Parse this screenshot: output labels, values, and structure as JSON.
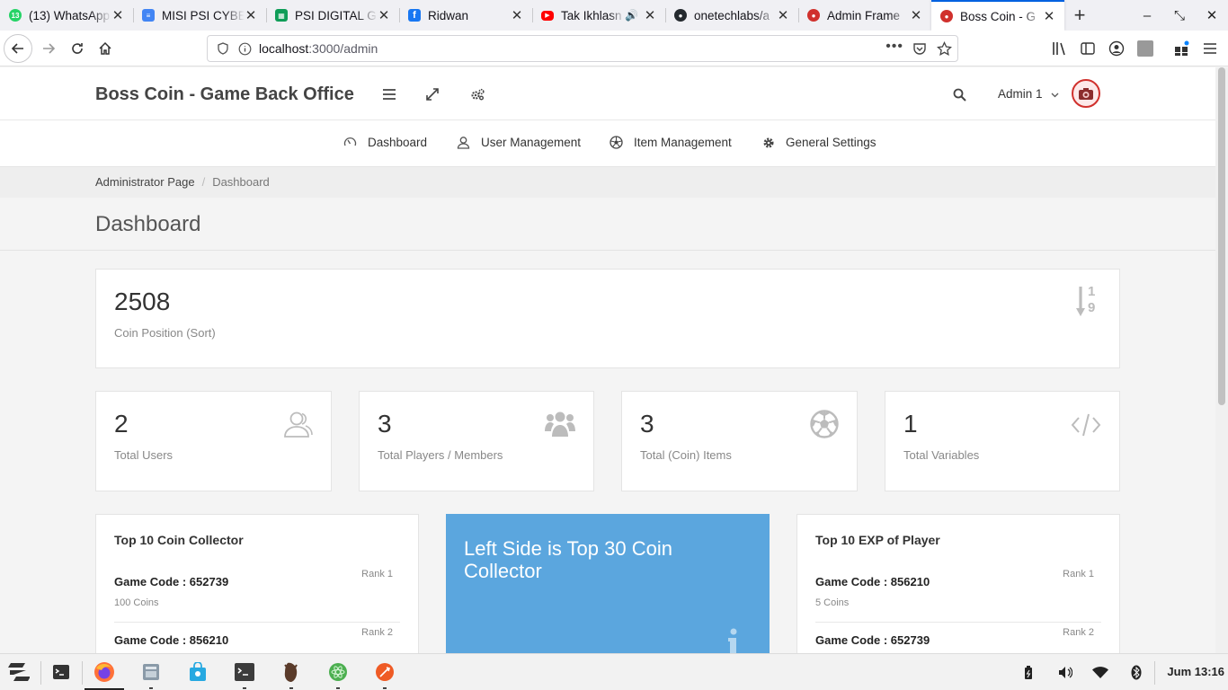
{
  "browser": {
    "tabs": [
      {
        "title": "(13) WhatsApp",
        "icon": "whatsapp-icon",
        "badge": "13",
        "color": "#25d366"
      },
      {
        "title": "MISI PSI CYBER",
        "icon": "google-docs-icon",
        "color": "#4285f4"
      },
      {
        "title": "PSI DIGITAL G",
        "icon": "google-sheets-icon",
        "color": "#0f9d58"
      },
      {
        "title": "Ridwan",
        "icon": "facebook-icon",
        "color": "#1877f2"
      },
      {
        "title": "Tak Ikhlasn",
        "icon": "youtube-icon",
        "color": "#ff0000"
      },
      {
        "title": "onetechlabs/a",
        "icon": "github-icon",
        "color": "#24292e"
      },
      {
        "title": "Admin Frame",
        "icon": "app-icon",
        "color": "#d0312d"
      },
      {
        "title": "Boss Coin - G",
        "icon": "app-icon",
        "color": "#d0312d",
        "active": true
      }
    ],
    "url_host": "localhost",
    "url_path": ":3000/admin"
  },
  "header": {
    "brand": "Boss Coin - Game Back Office",
    "admin_name": "Admin 1"
  },
  "nav": {
    "items": [
      {
        "label": "Dashboard",
        "icon": "dashboard-gauge-icon"
      },
      {
        "label": "User Management",
        "icon": "user-icon"
      },
      {
        "label": "Item Management",
        "icon": "soccer-ball-icon"
      },
      {
        "label": "General Settings",
        "icon": "gear-icon"
      }
    ]
  },
  "breadcrumb": {
    "root": "Administrator Page",
    "separator": "/",
    "current": "Dashboard"
  },
  "page": {
    "title": "Dashboard"
  },
  "stats": {
    "coin_position": {
      "value": "2508",
      "label": "Coin Position (Sort)",
      "icon": "sort-numeric-icon",
      "icon_digits": [
        "1",
        "9"
      ]
    },
    "cards": [
      {
        "value": "2",
        "label": "Total Users",
        "icon": "users-outline-icon"
      },
      {
        "value": "3",
        "label": "Total Players / Members",
        "icon": "group-icon"
      },
      {
        "value": "3",
        "label": "Total (Coin) Items",
        "icon": "soccer-ball-icon"
      },
      {
        "value": "1",
        "label": "Total Variables",
        "icon": "code-icon"
      }
    ]
  },
  "top_coin": {
    "title": "Top 10 Coin Collector",
    "rows": [
      {
        "code": "Game Code : 652739",
        "amount": "100 Coins",
        "rank": "Rank 1"
      },
      {
        "code": "Game Code : 856210",
        "rank": "Rank 2"
      }
    ]
  },
  "info_panel": {
    "text": "Left Side is Top 30 Coin Collector",
    "color": "#5ba6de"
  },
  "top_exp": {
    "title": "Top 10 EXP of Player",
    "rows": [
      {
        "code": "Game Code : 856210",
        "amount": "5 Coins",
        "rank": "Rank 1"
      },
      {
        "code": "Game Code : 652739",
        "rank": "Rank 2"
      }
    ]
  },
  "taskbar": {
    "clock": "Jum 13:16"
  }
}
